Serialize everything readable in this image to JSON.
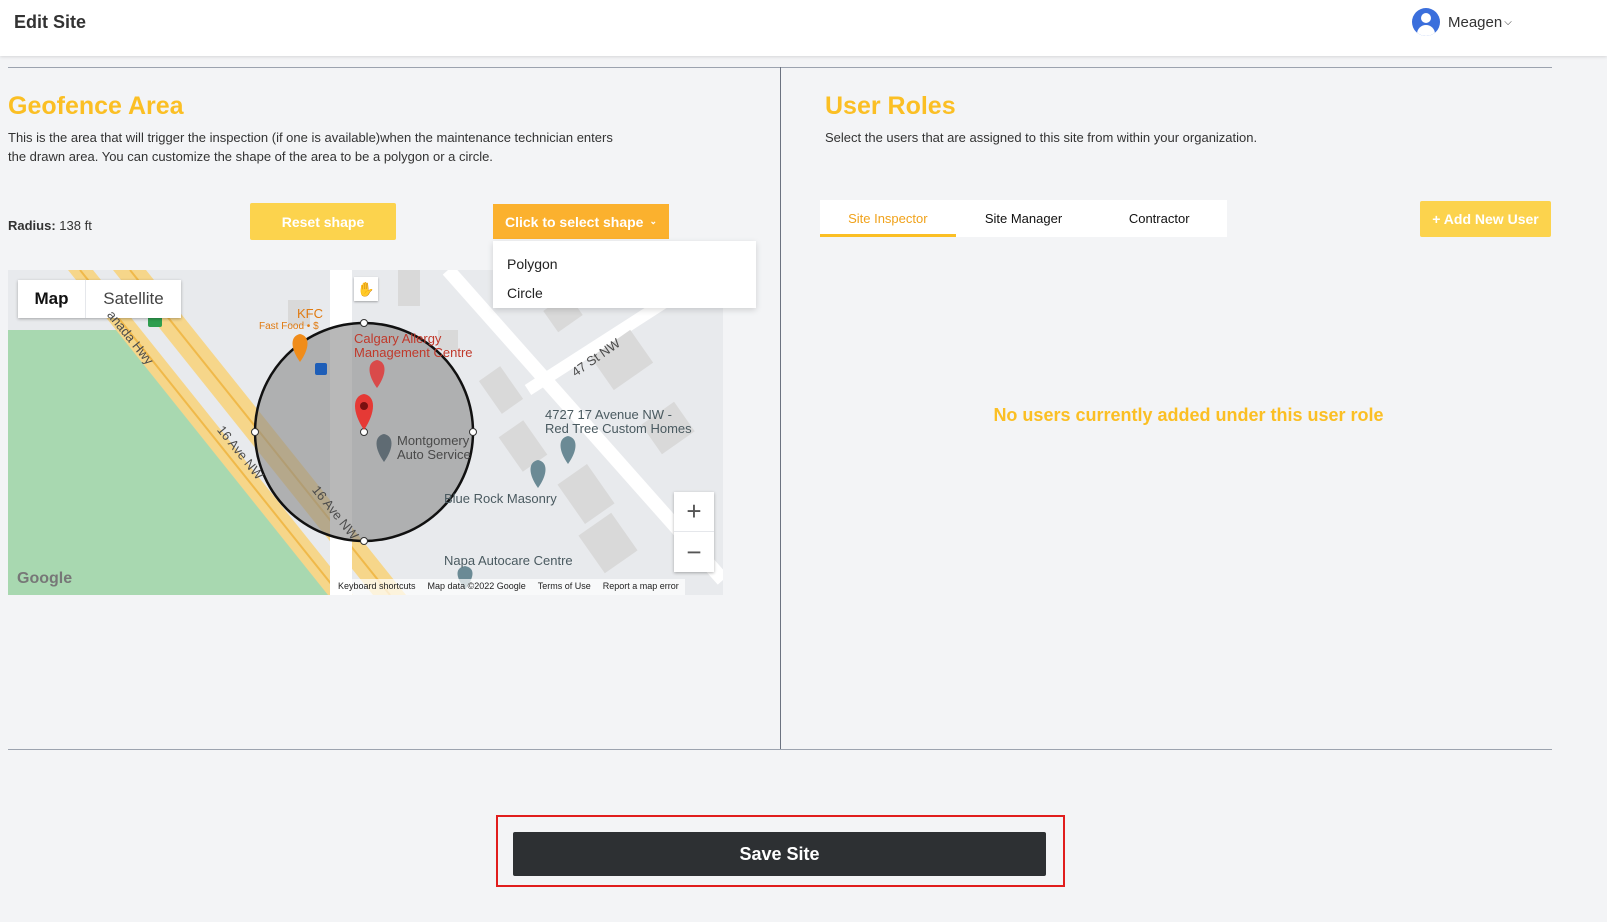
{
  "header": {
    "title": "Edit Site",
    "user_name": "Meagen"
  },
  "geofence": {
    "title": "Geofence Area",
    "description_line1": "This is the area that will trigger the inspection (if one is available)when the maintenance technician enters",
    "description_line2": "the drawn area. You can customize the shape of the area to be a polygon or a circle.",
    "radius_label": "Radius:",
    "radius_value": "138 ft",
    "reset_button": "Reset shape",
    "shape_button": "Click to select shape",
    "shape_options": [
      "Polygon",
      "Circle"
    ]
  },
  "map": {
    "type_map": "Map",
    "type_satellite": "Satellite",
    "zoom_in": "+",
    "zoom_out": "−",
    "logo": "Google",
    "attribution": [
      "Keyboard shortcuts",
      "Map data ©2022 Google",
      "Terms of Use",
      "Report a map error"
    ],
    "labels": {
      "kfc": "KFC",
      "kfc_sub": "Fast Food • $",
      "clinic_1": "Calgary Allergy",
      "clinic_2": "Management Centre",
      "montgomery_1": "Montgomery",
      "montgomery_2": "Auto Service",
      "avenue_1": "4727 17 Avenue NW -",
      "avenue_2": "Red Tree Custom Homes",
      "masonry": "Blue Rock Masonry",
      "napa": "Napa Autocare Centre",
      "road_hwy": "anada Hwy",
      "road_16a": "16 Ave NW",
      "road_16b": "16 Ave NW",
      "road_47": "47 St NW"
    }
  },
  "user_roles": {
    "title": "User Roles",
    "description": "Select the users that are assigned to this site from within your organization.",
    "tabs": [
      "Site Inspector",
      "Site Manager",
      "Contractor"
    ],
    "add_button": "+ Add New User",
    "empty_message": "No users currently added under this user role"
  },
  "footer": {
    "save_button": "Save Site"
  },
  "colors": {
    "accent_yellow": "#fbbf24",
    "button_orange": "#fbb12e",
    "save_dark": "#2d3033",
    "highlight_red": "#e11d1d"
  }
}
